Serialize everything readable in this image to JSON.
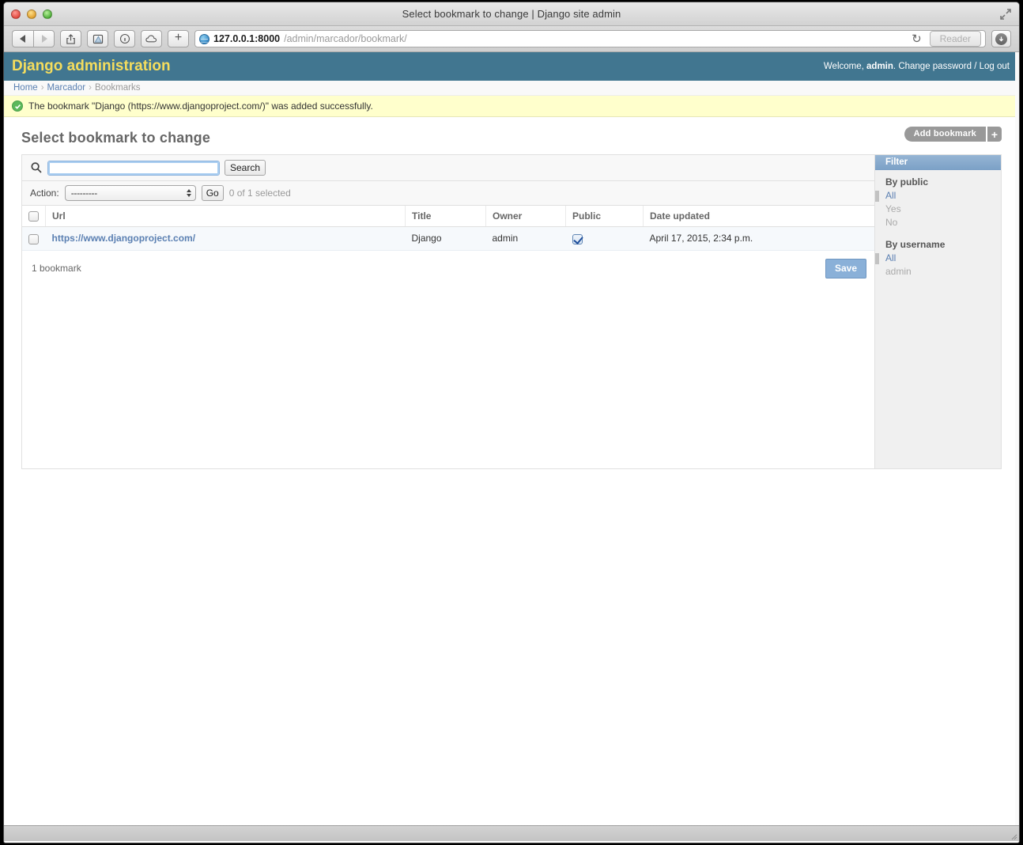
{
  "window": {
    "title": "Select bookmark to change | Django site admin",
    "traffic_lights": [
      "close-button",
      "minimize-button",
      "zoom-button"
    ],
    "fullscreen_icon": "fullscreen-icon"
  },
  "browser": {
    "back_icon": "back-arrow-icon",
    "forward_icon": "forward-arrow-icon",
    "share_icon": "share-icon",
    "reading_list_icon": "reading-list-icon",
    "top_sites_icon": "top-sites-icon",
    "icloud_icon": "icloud-icon",
    "new_tab_label": "+",
    "site_icon": "globe-icon",
    "url_host": "127.0.0.1:8000",
    "url_path": "/admin/marcador/bookmark/",
    "reload_icon": "↻",
    "reader_label": "Reader",
    "downloads_icon": "downloads-icon"
  },
  "admin_header": {
    "brand": "Django administration",
    "welcome_prefix": "Welcome,",
    "username": "admin",
    "welcome_suffix": ".",
    "change_password_label": "Change password",
    "separator": "/",
    "logout_label": "Log out"
  },
  "breadcrumbs": {
    "items": [
      {
        "label": "Home",
        "link": true
      },
      {
        "label": "Marcador",
        "link": true
      },
      {
        "label": "Bookmarks",
        "link": false
      }
    ],
    "separator": "›"
  },
  "message": {
    "icon": "success-check-icon",
    "text": "The bookmark \"Django (https://www.djangoproject.com/)\" was added successfully."
  },
  "page": {
    "title": "Select bookmark to change",
    "add_button_label": "Add bookmark",
    "add_button_plus": "+"
  },
  "search": {
    "icon": "search-icon",
    "value": "",
    "placeholder": "",
    "button_label": "Search"
  },
  "actions": {
    "label": "Action:",
    "selected_option": "---------",
    "options": [
      "---------"
    ],
    "go_label": "Go",
    "counter": "0 of 1 selected"
  },
  "table": {
    "select_all_checkbox": "select-all-checkbox",
    "columns": [
      "Url",
      "Title",
      "Owner",
      "Public",
      "Date updated"
    ],
    "rows": [
      {
        "selected": false,
        "url": "https://www.djangoproject.com/",
        "title": "Django",
        "owner": "admin",
        "public": true,
        "date_updated": "April 17, 2015, 2:34 p.m."
      }
    ]
  },
  "footer": {
    "count_label": "1 bookmark",
    "save_label": "Save"
  },
  "filter": {
    "header": "Filter",
    "groups": [
      {
        "title": "By public",
        "options": [
          {
            "label": "All",
            "selected": true
          },
          {
            "label": "Yes",
            "selected": false
          },
          {
            "label": "No",
            "selected": false
          }
        ]
      },
      {
        "title": "By username",
        "options": [
          {
            "label": "All",
            "selected": true
          },
          {
            "label": "admin",
            "selected": false
          }
        ]
      }
    ]
  },
  "colors": {
    "django_header": "#417690",
    "brand_yellow": "#f5dd5d",
    "link_blue": "#5b80b2",
    "message_bg": "#ffffcc",
    "row_bg": "#f6f9fc",
    "filter_header": "#7ba0c6",
    "save_button": "#8ab0d8"
  }
}
